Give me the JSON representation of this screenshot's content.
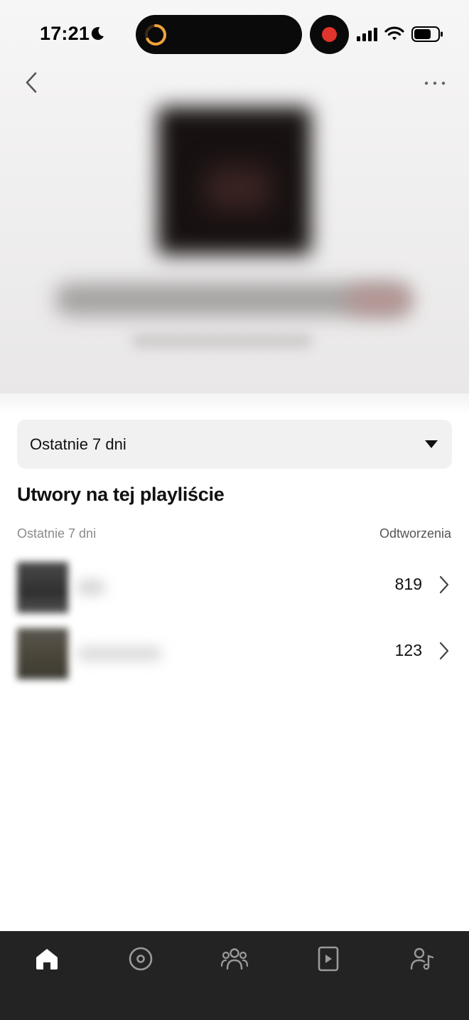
{
  "status_bar": {
    "time": "17:21",
    "icons": [
      "moon-icon",
      "activity-ring-icon",
      "recording-icon",
      "cellular-signal-icon",
      "wifi-icon",
      "battery-icon"
    ]
  },
  "nav": {
    "back_icon": "chevron-left-icon",
    "more_icon": "more-horizontal-icon"
  },
  "filter": {
    "selected": "Ostatnie 7 dni",
    "icon": "caret-down-icon"
  },
  "section": {
    "title": "Utwory na tej playliście",
    "col_period": "Ostatnie 7 dni",
    "col_plays": "Odtworzenia"
  },
  "tracks": [
    {
      "plays": "819"
    },
    {
      "plays": "123"
    }
  ],
  "tab_bar": {
    "tabs": [
      {
        "icon": "home-icon",
        "active": true
      },
      {
        "icon": "target-icon",
        "active": false
      },
      {
        "icon": "audience-icon",
        "active": false
      },
      {
        "icon": "video-icon",
        "active": false
      },
      {
        "icon": "artist-icon",
        "active": false
      }
    ]
  },
  "colors": {
    "tab_bar_bg": "#232323",
    "recording": "#e0342c",
    "activity_ring": "#f0a23a",
    "dropdown_bg": "#f1f1f1"
  }
}
